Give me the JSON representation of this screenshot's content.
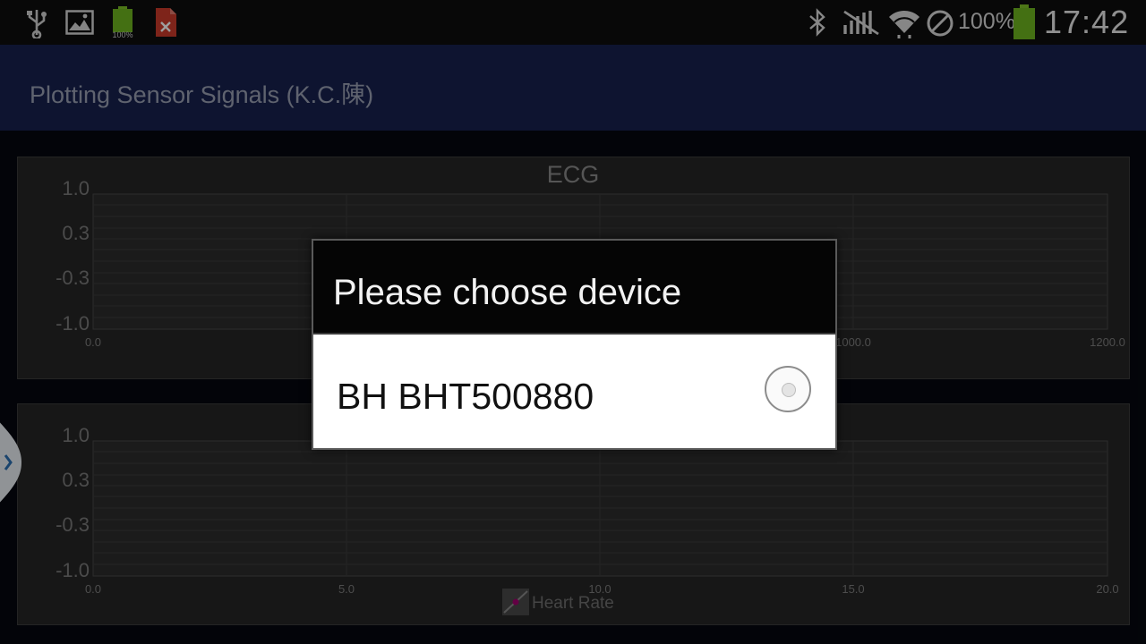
{
  "status_bar": {
    "battery_percent": "100%",
    "time": "17:42",
    "icons": [
      "usb-icon",
      "image-icon",
      "battery-widget-icon",
      "file-error-icon",
      "bluetooth-icon",
      "no-signal-icon",
      "wifi-icon",
      "blocked-icon",
      "battery-icon"
    ],
    "battery_widget_label": "100%"
  },
  "action_bar": {
    "title": "Plotting Sensor Signals (K.C.陳)"
  },
  "plots": [
    {
      "title": "ECG",
      "y_ticks": [
        "1.0",
        "0.3",
        "-0.3",
        "-1.0"
      ],
      "x_ticks": [
        "0.0",
        "",
        "",
        "1000.0",
        "1200.0"
      ]
    },
    {
      "title": "",
      "y_ticks": [
        "1.0",
        "0.3",
        "-0.3",
        "-1.0"
      ],
      "x_ticks": [
        "0.0",
        "5.0",
        "10.0",
        "15.0",
        "20.0"
      ],
      "legend": "Heart Rate",
      "legend_color": "#a0006e"
    }
  ],
  "dialog": {
    "title": "Please choose device",
    "items": [
      {
        "label": "BH BHT500880",
        "selected": false
      }
    ]
  },
  "colors": {
    "action_bar": "#17214e",
    "panel": "#262626",
    "dialog_header": "#050505"
  }
}
